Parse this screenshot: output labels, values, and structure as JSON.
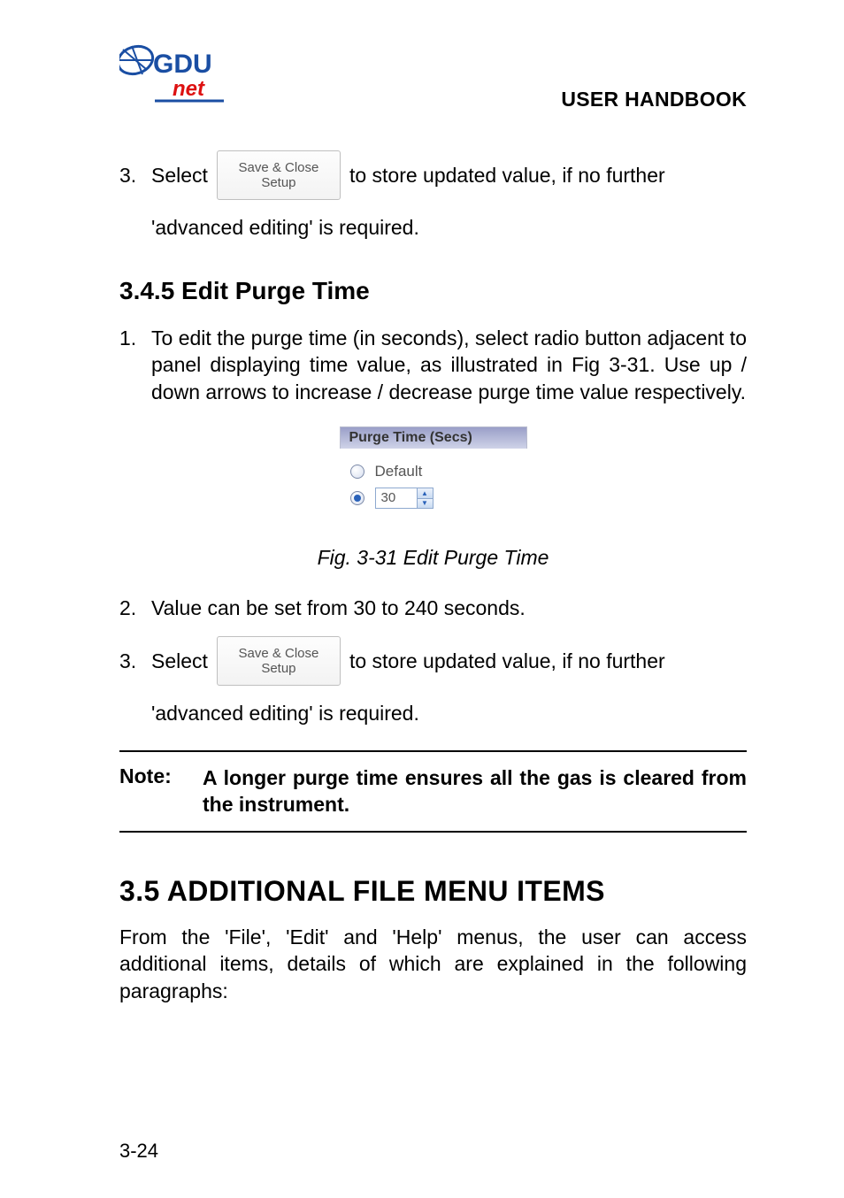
{
  "header": {
    "title": "USER HANDBOOK"
  },
  "logo": {
    "brand_top": "GDU",
    "brand_bottom": "net"
  },
  "save_close_btn": {
    "line1": "Save & Close",
    "line2": "Setup"
  },
  "step3_top": {
    "num": "3.",
    "pre": "Select",
    "post": "to store updated value, if no further",
    "cont": "'advanced editing' is required."
  },
  "section_345": {
    "heading": "3.4.5  Edit Purge Time",
    "step1_num": "1.",
    "step1_text": "To edit the purge time (in seconds), select radio button adjacent to panel displaying time value, as illustrated in Fig 3-31. Use up / down arrows to increase / decrease purge time value respectively.",
    "purge_header": "Purge Time (Secs)",
    "default_label": "Default",
    "spinner_value": "30",
    "fig_caption": "Fig. 3-31  Edit Purge Time",
    "step2_num": "2.",
    "step2_text": "Value can be set from 30 to 240 seconds.",
    "step3_num": "3.",
    "step3_pre": "Select",
    "step3_post": "to store updated value, if no further",
    "step3_cont": "'advanced editing' is required."
  },
  "note": {
    "label": "Note:",
    "text": "A longer purge time ensures all the gas is cleared from the instrument."
  },
  "section_35": {
    "heading": "3.5  ADDITIONAL FILE MENU ITEMS",
    "body": "From the 'File', 'Edit' and 'Help' menus, the user can access additional items, details of which are explained in the following paragraphs:"
  },
  "page_number": "3-24"
}
